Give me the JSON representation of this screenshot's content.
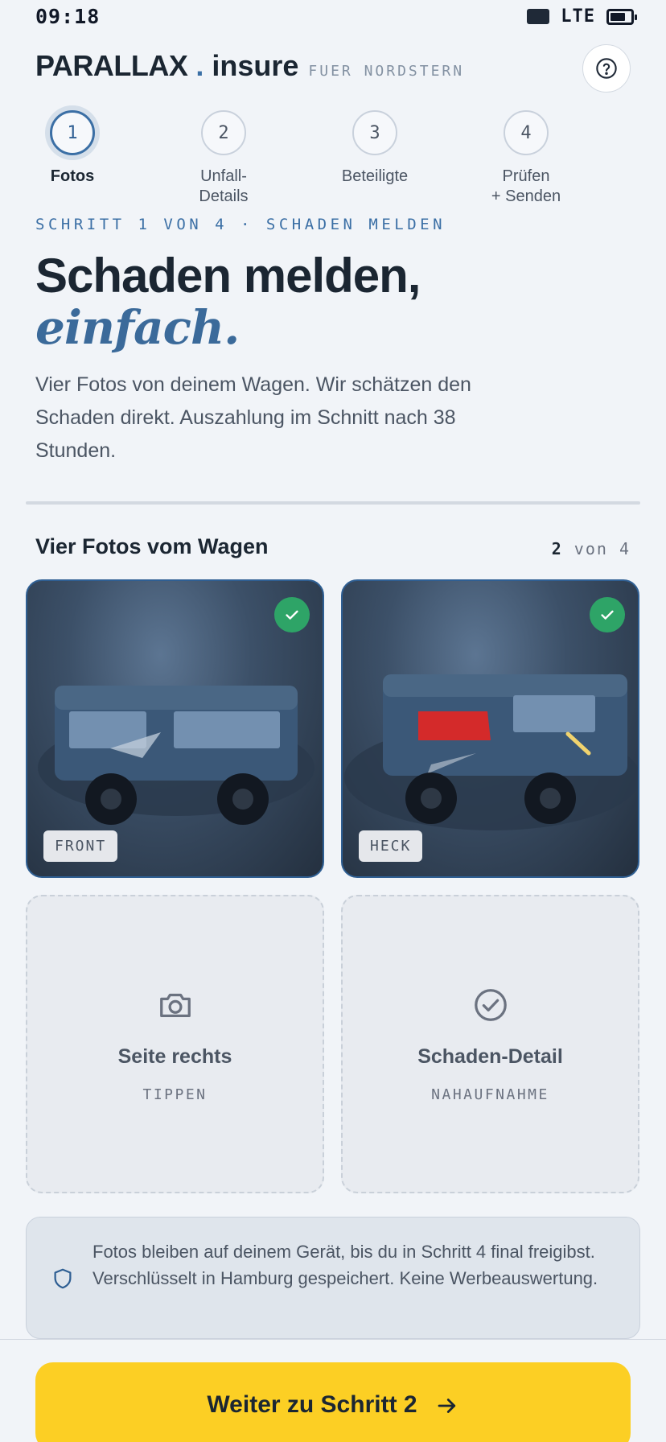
{
  "status_bar": {
    "time": "09:18",
    "network": "LTE"
  },
  "header": {
    "brand_name": "PARALLAX",
    "brand_dot": ".",
    "brand_product": "insure",
    "brand_sub": "FUER NORDSTERN",
    "help_icon": "question-circle-icon"
  },
  "stepper": {
    "steps": [
      {
        "number": "1",
        "label": "Fotos",
        "active": true
      },
      {
        "number": "2",
        "label": "Unfall-\nDetails",
        "active": false
      },
      {
        "number": "3",
        "label": "Beteiligte",
        "active": false
      },
      {
        "number": "4",
        "label": "Prüfen\n+ Senden",
        "active": false
      }
    ]
  },
  "intro": {
    "eyebrow": "SCHRITT 1 VON 4 · SCHADEN MELDEN",
    "headline": "Schaden melden,",
    "headline_em": "einfach.",
    "lead": "Vier Fotos von deinem Wagen. Wir schätzen den Schaden direkt. Auszahlung im Schnitt nach 38 Stunden."
  },
  "photos": {
    "title": "Vier Fotos vom Wagen",
    "count_done": "2",
    "count_rest": "von 4",
    "cards": [
      {
        "tag": "FRONT",
        "done": true
      },
      {
        "tag": "HECK",
        "done": true
      },
      {
        "title": "Seite rechts",
        "sub": "TIPPEN",
        "icon": "camera-icon"
      },
      {
        "title": "Schaden-Detail",
        "sub": "NAHAUFNAHME",
        "icon": "check-circle-icon"
      }
    ]
  },
  "notice": {
    "icon": "shield-icon",
    "text": "Fotos bleiben auf deinem Gerät, bis du in Schritt 4 final freigibst. Verschlüsselt in Hamburg gespeichert. Keine Werbeauswertung."
  },
  "cta": {
    "label": "Weiter zu Schritt 2",
    "icon": "arrow-right-icon"
  },
  "colors": {
    "accent": "#3b6fa5",
    "success": "#2ea467",
    "cta": "#fccf24",
    "damage": "#d42a2a"
  }
}
